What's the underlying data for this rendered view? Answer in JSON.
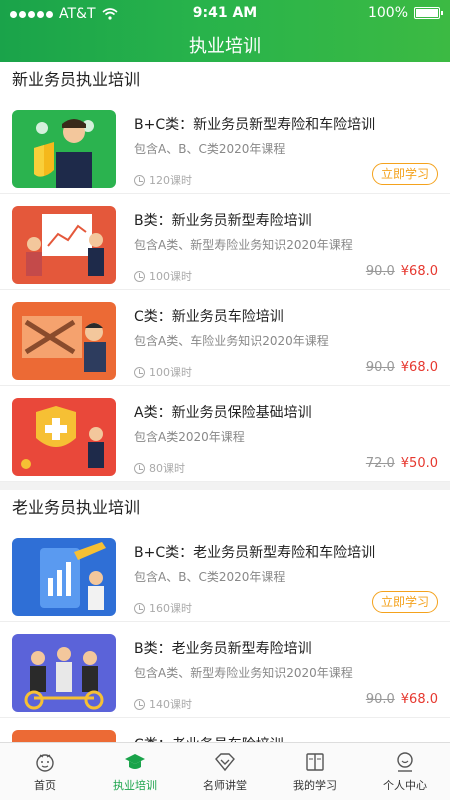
{
  "status_bar": {
    "carrier": "AT&T",
    "time": "9:41 AM",
    "battery": "100%"
  },
  "nav": {
    "title": "执业培训"
  },
  "sections": [
    {
      "title": "新业务员执业培训",
      "courses": [
        {
          "title": "B+C类：新业务员新型寿险和车险培训",
          "subtitle": "包含A、B、C类2020年课程",
          "hours": "120课时",
          "action": "立即学习"
        },
        {
          "title": "B类：新业务员新型寿险培训",
          "subtitle": "包含A类、新型寿险业务知识2020年课程",
          "hours": "100课时",
          "old_price": "90.0",
          "price": "¥68.0"
        },
        {
          "title": "C类：新业务员车险培训",
          "subtitle": "包含A类、车险业务知识2020年课程",
          "hours": "100课时",
          "old_price": "90.0",
          "price": "¥68.0"
        },
        {
          "title": "A类：新业务员保险基础培训",
          "subtitle": "包含A类2020年课程",
          "hours": "80课时",
          "old_price": "72.0",
          "price": "¥50.0"
        }
      ]
    },
    {
      "title": "老业务员执业培训",
      "courses": [
        {
          "title": "B+C类：老业务员新型寿险和车险培训",
          "subtitle": "包含A、B、C类2020年课程",
          "hours": "160课时",
          "action": "立即学习"
        },
        {
          "title": "B类：老业务员新型寿险培训",
          "subtitle": "包含A类、新型寿险业务知识2020年课程",
          "hours": "140课时",
          "old_price": "90.0",
          "price": "¥68.0"
        },
        {
          "title": "C类：老业务员车险培训",
          "subtitle": "",
          "hours": ""
        }
      ]
    }
  ],
  "tabbar": [
    {
      "label": "首页",
      "icon": "home-icon"
    },
    {
      "label": "执业培训",
      "icon": "training-icon",
      "active": true
    },
    {
      "label": "名师讲堂",
      "icon": "lecture-icon"
    },
    {
      "label": "我的学习",
      "icon": "book-icon"
    },
    {
      "label": "个人中心",
      "icon": "profile-icon"
    }
  ],
  "colors": {
    "brand_green": "#1aa34a",
    "accent_orange": "#f4a21d",
    "price_red": "#e6382f"
  }
}
